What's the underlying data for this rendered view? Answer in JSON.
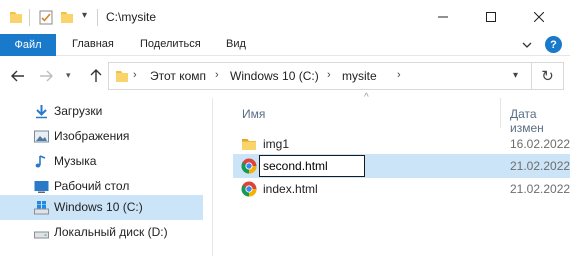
{
  "window": {
    "title": "C:\\mysite"
  },
  "ribbon": {
    "file_label": "Файл",
    "tabs": [
      "Главная",
      "Поделиться",
      "Вид"
    ],
    "help_label": "?"
  },
  "address": {
    "crumbs": [
      "Этот комп",
      "Windows 10 (C:)",
      "mysite"
    ]
  },
  "navpane": {
    "items": [
      {
        "label": "Загрузки",
        "icon": "download-arrow-icon",
        "selected": false
      },
      {
        "label": "Изображения",
        "icon": "pictures-icon",
        "selected": false
      },
      {
        "label": "Музыка",
        "icon": "music-note-icon",
        "selected": false
      },
      {
        "label": "Рабочий стол",
        "icon": "desktop-icon",
        "selected": false
      },
      {
        "label": "Windows 10 (C:)",
        "icon": "windows-drive-icon",
        "selected": true
      },
      {
        "label": "Локальный диск (D:)",
        "icon": "drive-icon",
        "selected": false
      }
    ]
  },
  "content": {
    "columns": {
      "name": "Имя",
      "date": "Дата измен"
    },
    "files": [
      {
        "name": "img1",
        "date": "16.02.2022",
        "icon": "folder-icon",
        "selected": false,
        "renaming": false
      },
      {
        "name": "second.html",
        "date": "21.02.2022",
        "icon": "chrome-html-icon",
        "selected": true,
        "renaming": true
      },
      {
        "name": "index.html",
        "date": "21.02.2022",
        "icon": "chrome-html-icon",
        "selected": false,
        "renaming": false
      }
    ]
  },
  "colors": {
    "accent": "#1979ca",
    "selection": "#cce4f7",
    "folder": "#f3c244"
  }
}
